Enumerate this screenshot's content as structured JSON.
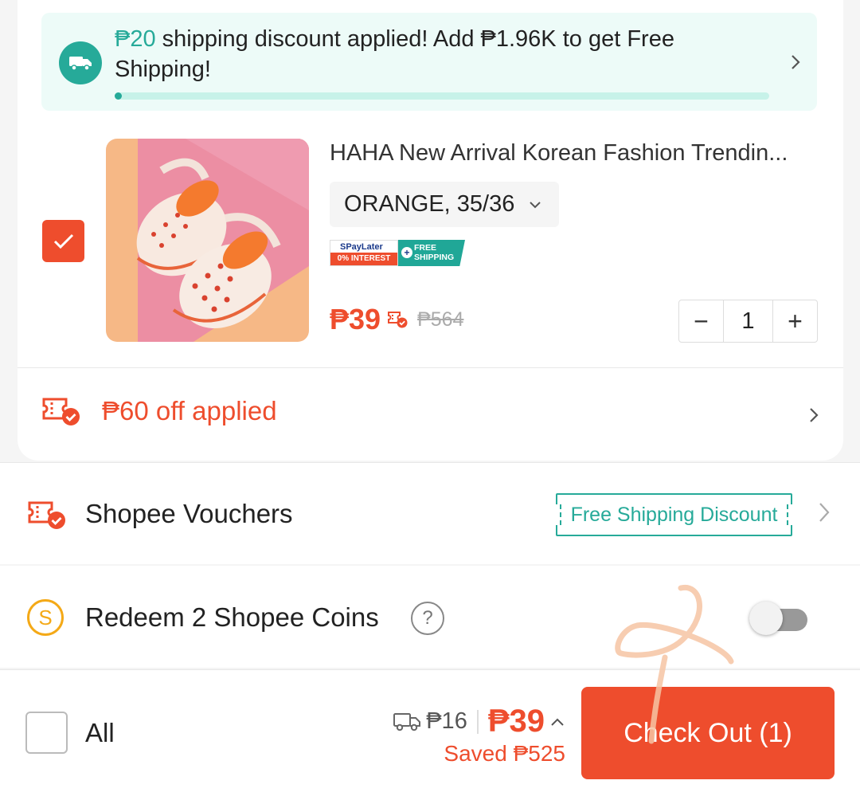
{
  "colors": {
    "brand": "#ee4d2d",
    "teal": "#26aa99",
    "coin": "#f4a917"
  },
  "shipping_banner": {
    "amount": "₱20",
    "message": " shipping discount applied! Add ₱1.96K to get Free Shipping!",
    "progress": 0.01,
    "icon": "truck-icon"
  },
  "cart_item": {
    "selected": true,
    "title": "HAHA New Arrival Korean Fashion Trendin...",
    "variant": "ORANGE, 35/36",
    "badges": {
      "spaylater": "SPayLater",
      "interest": "0% INTEREST",
      "free_shipping_line1": "FREE",
      "free_shipping_line2": "SHIPPING"
    },
    "price": "₱39",
    "original_price": "₱564",
    "quantity": "1",
    "minus": "−",
    "plus": "+"
  },
  "shop_voucher": {
    "label": "₱60 off applied",
    "icon": "voucher-icon"
  },
  "shopee_vouchers": {
    "label": "Shopee Vouchers",
    "tag": "Free Shipping Discount"
  },
  "coins": {
    "label": "Redeem 2 Shopee Coins",
    "coin_symbol": "S",
    "help": "?",
    "enabled": false
  },
  "bottom": {
    "all_label": "All",
    "shipping_fee": "₱16",
    "total": "₱39",
    "saved": "Saved ₱525",
    "checkout": "Check Out (1)"
  }
}
